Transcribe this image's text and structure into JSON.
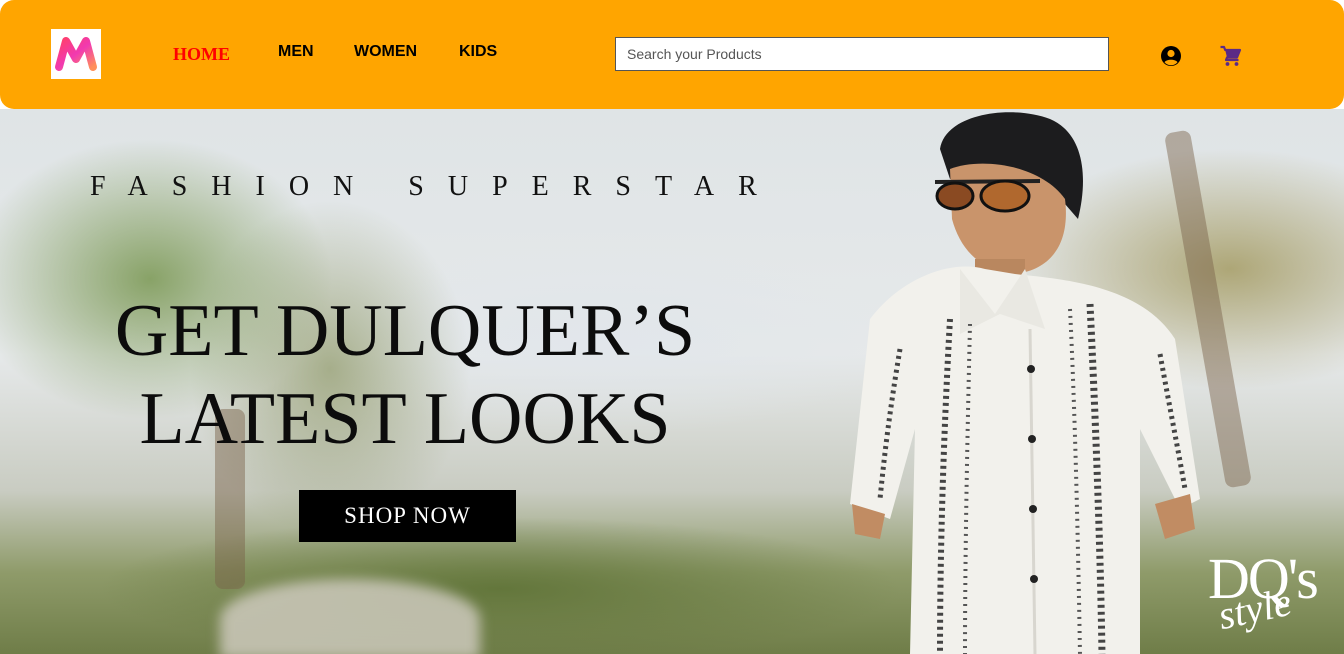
{
  "header": {
    "logo_icon": "myntra-m-logo",
    "nav": [
      {
        "label": "HOME",
        "active": true
      },
      {
        "label": "MEN",
        "active": false
      },
      {
        "label": "WOMEN",
        "active": false
      },
      {
        "label": "KIDS",
        "active": false
      }
    ],
    "search": {
      "placeholder": "Search your Products",
      "value": ""
    },
    "account_icon": "account-circle-icon",
    "cart_icon": "shopping-cart-icon",
    "colors": {
      "bar": "#ffa500",
      "active_nav": "#ff0000",
      "cart": "#5b2a86"
    }
  },
  "hero": {
    "kicker": "FASHION SUPERSTAR",
    "headline_line1": "GET DULQUER’S",
    "headline_line2": "LATEST LOOKS",
    "cta": "SHOP NOW",
    "brand_mark": "DQ's",
    "brand_script": "style"
  }
}
